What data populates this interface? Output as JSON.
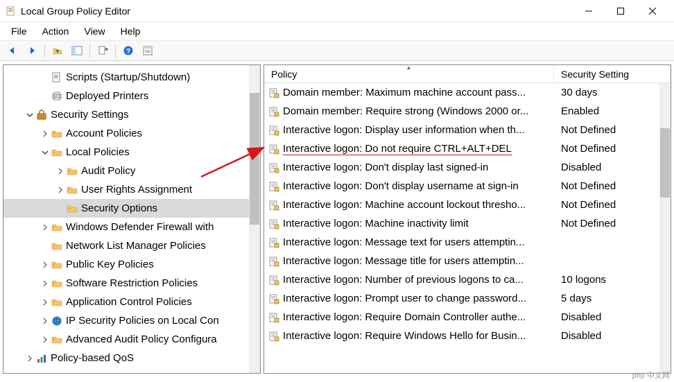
{
  "window": {
    "title": "Local Group Policy Editor"
  },
  "menu": {
    "file": "File",
    "action": "Action",
    "view": "View",
    "help": "Help"
  },
  "tree": {
    "items": [
      {
        "indent": 2,
        "expander": "",
        "icon": "script",
        "label": "Scripts (Startup/Shutdown)",
        "selected": false
      },
      {
        "indent": 2,
        "expander": "",
        "icon": "printer",
        "label": "Deployed Printers",
        "selected": false
      },
      {
        "indent": 1,
        "expander": "down",
        "icon": "security",
        "label": "Security Settings",
        "selected": false
      },
      {
        "indent": 2,
        "expander": "right",
        "icon": "folder",
        "label": "Account Policies",
        "selected": false
      },
      {
        "indent": 2,
        "expander": "down",
        "icon": "folder",
        "label": "Local Policies",
        "selected": false
      },
      {
        "indent": 3,
        "expander": "right",
        "icon": "folder",
        "label": "Audit Policy",
        "selected": false
      },
      {
        "indent": 3,
        "expander": "right",
        "icon": "folder",
        "label": "User Rights Assignment",
        "selected": false
      },
      {
        "indent": 3,
        "expander": "",
        "icon": "folder",
        "label": "Security Options",
        "selected": true
      },
      {
        "indent": 2,
        "expander": "right",
        "icon": "folder",
        "label": "Windows Defender Firewall with",
        "selected": false
      },
      {
        "indent": 2,
        "expander": "",
        "icon": "folder",
        "label": "Network List Manager Policies",
        "selected": false
      },
      {
        "indent": 2,
        "expander": "right",
        "icon": "folder",
        "label": "Public Key Policies",
        "selected": false
      },
      {
        "indent": 2,
        "expander": "right",
        "icon": "folder",
        "label": "Software Restriction Policies",
        "selected": false
      },
      {
        "indent": 2,
        "expander": "right",
        "icon": "folder",
        "label": "Application Control Policies",
        "selected": false
      },
      {
        "indent": 2,
        "expander": "right",
        "icon": "ipsec",
        "label": "IP Security Policies on Local Con",
        "selected": false
      },
      {
        "indent": 2,
        "expander": "right",
        "icon": "folder",
        "label": "Advanced Audit Policy Configura",
        "selected": false
      },
      {
        "indent": 1,
        "expander": "right",
        "icon": "qos",
        "label": "Policy-based QoS",
        "selected": false
      }
    ]
  },
  "list": {
    "columns": {
      "policy": "Policy",
      "setting": "Security Setting"
    },
    "rows": [
      {
        "policy": "Domain member: Maximum machine account pass...",
        "setting": "30 days",
        "hl": false
      },
      {
        "policy": "Domain member: Require strong (Windows 2000 or...",
        "setting": "Enabled",
        "hl": false
      },
      {
        "policy": "Interactive logon: Display user information when th...",
        "setting": "Not Defined",
        "hl": false
      },
      {
        "policy": "Interactive logon: Do not require CTRL+ALT+DEL",
        "setting": "Not Defined",
        "hl": true
      },
      {
        "policy": "Interactive logon: Don't display last signed-in",
        "setting": "Disabled",
        "hl": false
      },
      {
        "policy": "Interactive logon: Don't display username at sign-in",
        "setting": "Not Defined",
        "hl": false
      },
      {
        "policy": "Interactive logon: Machine account lockout thresho...",
        "setting": "Not Defined",
        "hl": false
      },
      {
        "policy": "Interactive logon: Machine inactivity limit",
        "setting": "Not Defined",
        "hl": false
      },
      {
        "policy": "Interactive logon: Message text for users attemptin...",
        "setting": "",
        "hl": false
      },
      {
        "policy": "Interactive logon: Message title for users attemptin...",
        "setting": "",
        "hl": false
      },
      {
        "policy": "Interactive logon: Number of previous logons to ca...",
        "setting": "10 logons",
        "hl": false
      },
      {
        "policy": "Interactive logon: Prompt user to change password...",
        "setting": "5 days",
        "hl": false
      },
      {
        "policy": "Interactive logon: Require Domain Controller authe...",
        "setting": "Disabled",
        "hl": false
      },
      {
        "policy": "Interactive logon: Require Windows Hello for Busin...",
        "setting": "Disabled",
        "hl": false
      }
    ]
  },
  "watermark": "php 中文网"
}
